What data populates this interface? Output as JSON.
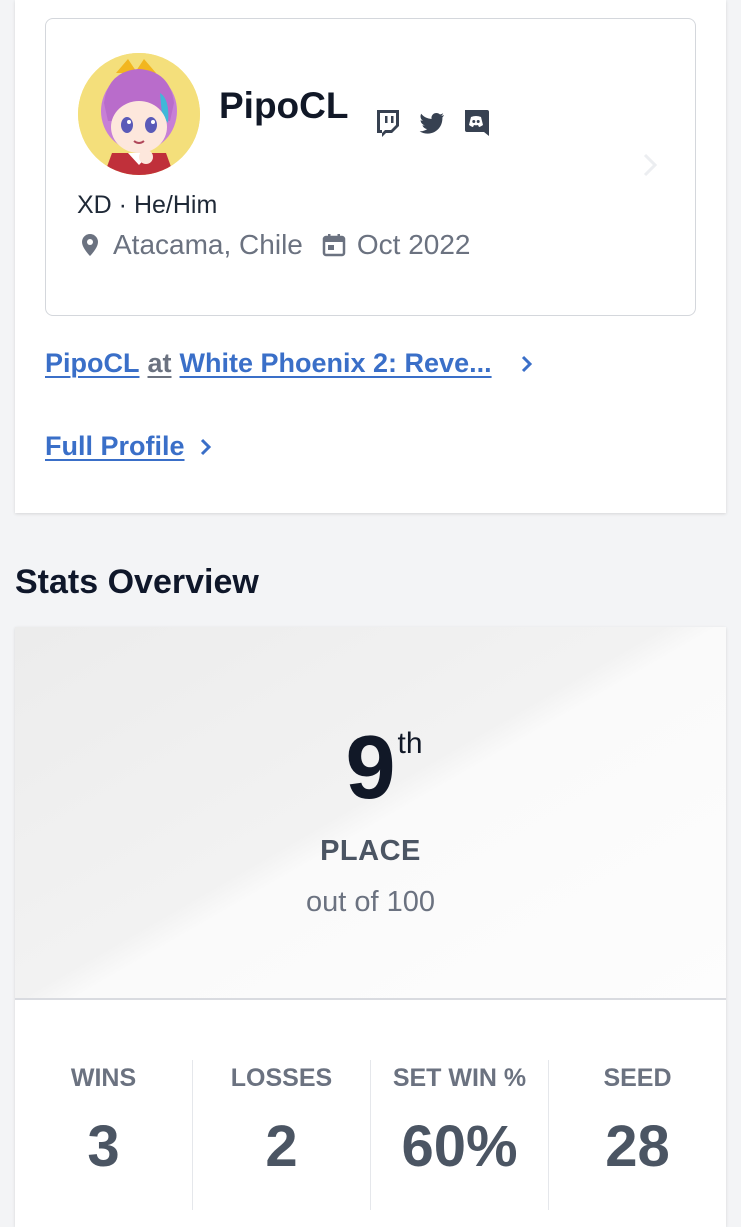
{
  "profile": {
    "player_name": "PipoCL",
    "pronouns_line": "XD · He/Him",
    "location": "Atacama, Chile",
    "joined": "Oct 2022",
    "socials": [
      "twitch-icon",
      "twitter-icon",
      "discord-icon"
    ]
  },
  "links": {
    "entrant_player": "PipoCL",
    "entrant_at": "at",
    "entrant_event": "White Phoenix 2: Reve...",
    "full_profile": "Full Profile"
  },
  "stats": {
    "section_title": "Stats Overview",
    "place_number": "9",
    "place_ordinal": "th",
    "place_label": "PLACE",
    "place_sub": "out of 100",
    "items": [
      {
        "label": "WINS",
        "value": "3"
      },
      {
        "label": "LOSSES",
        "value": "2"
      },
      {
        "label": "SET WIN %",
        "value": "60%"
      },
      {
        "label": "SEED",
        "value": "28"
      }
    ]
  },
  "colors": {
    "link": "#3a6fc8",
    "heading": "#0f172a",
    "muted": "#6b7280",
    "avatar_bg": "#f4df7b"
  }
}
